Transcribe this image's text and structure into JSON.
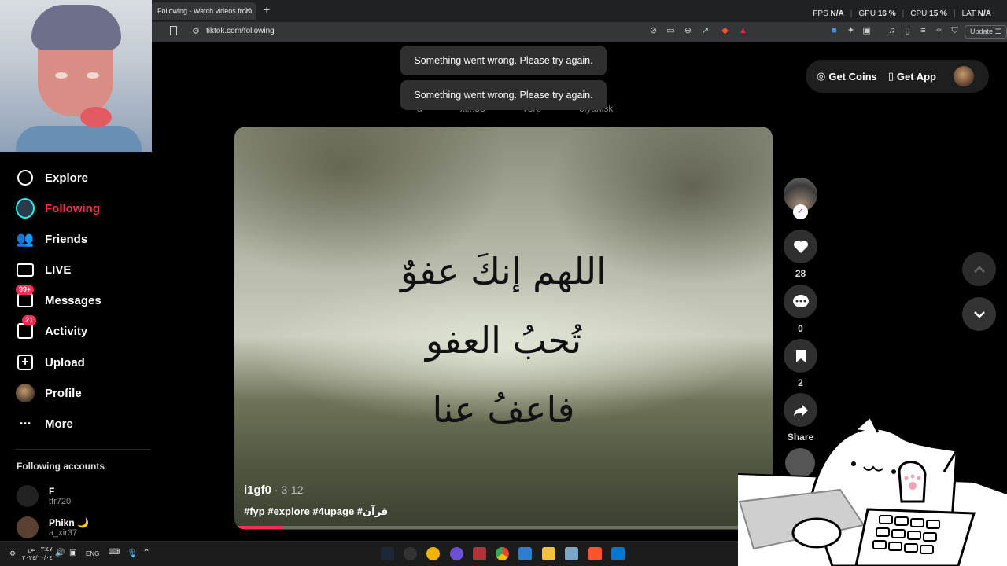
{
  "browser": {
    "tab_title": "Following - Watch videos from",
    "url": "tiktok.com/following",
    "update_label": "Update",
    "perf": {
      "fps_label": "FPS",
      "fps_value": "N/A",
      "gpu_label": "GPU",
      "gpu_value": "16 %",
      "cpu_label": "CPU",
      "cpu_value": "15 %",
      "lat_label": "LAT",
      "lat_value": "N/A"
    }
  },
  "sidebar": {
    "items": [
      {
        "label": "Explore",
        "icon": "compass-icon"
      },
      {
        "label": "Following",
        "icon": "following-avatar-icon",
        "active": true
      },
      {
        "label": "Friends",
        "icon": "friends-icon"
      },
      {
        "label": "LIVE",
        "icon": "live-tv-icon"
      },
      {
        "label": "Messages",
        "icon": "messages-icon",
        "badge": "99+"
      },
      {
        "label": "Activity",
        "icon": "activity-icon",
        "badge": "21"
      },
      {
        "label": "Upload",
        "icon": "upload-plus-icon"
      },
      {
        "label": "Profile",
        "icon": "profile-avatar-icon"
      },
      {
        "label": "More",
        "icon": "more-dots-icon"
      }
    ],
    "following_title": "Following accounts",
    "accounts": [
      {
        "name": "F",
        "username": "tfr720"
      },
      {
        "name": "Phikn 🌙",
        "username": "a_xir37"
      }
    ]
  },
  "header": {
    "get_coins": "Get Coins",
    "get_app": "Get App"
  },
  "toasts": [
    "Something went wrong. Please try again.",
    "Something went wrong. Please try again."
  ],
  "stories": [
    "a",
    "xi...33",
    "v3rp",
    "olyanisk"
  ],
  "video": {
    "overlay_lines": [
      "اللهم إنكَ عفوٌ",
      "تُحبُ العفو",
      "فاعفُ عنا"
    ],
    "author": "i1gf0",
    "date": " · 3-12",
    "tags": "#fyp #explore #4upage #قرآن",
    "progress": 0.09
  },
  "actions": {
    "likes": "28",
    "comments": "0",
    "saves": "2",
    "share_label": "Share"
  },
  "taskbar": {
    "time": "٠٣:٤٧ ص",
    "date": "٢٠٢٤/١٠/٠٤",
    "lang": "ENG"
  },
  "colors": {
    "accent": "#fe2c55",
    "bg": "#000000",
    "surface": "#2f2f2f"
  }
}
